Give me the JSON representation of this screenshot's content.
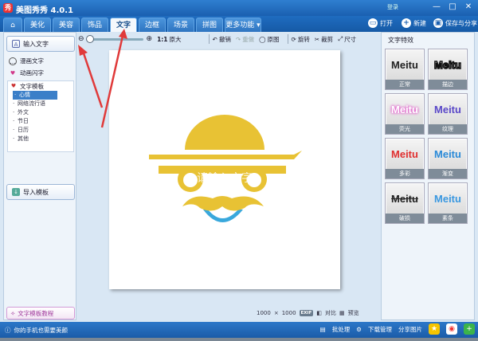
{
  "window": {
    "title": "美图秀秀 4.0.1",
    "controls": [
      "—",
      "□",
      "✕"
    ],
    "login": "登录"
  },
  "tabs": [
    {
      "id": "home",
      "label": "⌂",
      "active": false
    },
    {
      "id": "beautify",
      "label": "美化",
      "active": false
    },
    {
      "id": "face",
      "label": "美容",
      "active": false
    },
    {
      "id": "decor",
      "label": "饰品",
      "active": false
    },
    {
      "id": "text",
      "label": "文字",
      "active": true
    },
    {
      "id": "frame",
      "label": "边框",
      "active": false
    },
    {
      "id": "scene",
      "label": "场景",
      "active": false
    },
    {
      "id": "collage",
      "label": "拼图",
      "active": false
    },
    {
      "id": "more",
      "label": "更多功能 ▾",
      "active": false
    }
  ],
  "header_actions": {
    "open": "打开",
    "new": "新建",
    "save": "保存与分享"
  },
  "toolbar": {
    "original_size": "原大",
    "undo": "撤销",
    "redo": "重做",
    "original_image": "原图",
    "rotate": "旋转",
    "crop": "裁剪",
    "size": "尺寸"
  },
  "left_panel": {
    "input_text": "输入文字",
    "comic_text": "漫画文字",
    "animated_text": "动画闪字",
    "template_title": "文字模板",
    "templates": [
      "心情",
      "网络流行语",
      "外文",
      "节日",
      "日历",
      "其他"
    ],
    "import_template": "导入模板",
    "tutorial": "文字模板教程"
  },
  "canvas": {
    "overlay_text": "请输入文字",
    "width": "1000",
    "times": "×",
    "height": "1000",
    "exif": "EXIF",
    "compare": "对比",
    "preview": "预览"
  },
  "right_panel": {
    "title": "文字特效",
    "effects": [
      {
        "label": "正常",
        "preview": "Meitu",
        "color": "#222222"
      },
      {
        "label": "描边",
        "preview": "Meitu",
        "color": "#ffffff"
      },
      {
        "label": "荧光",
        "preview": "Meitu",
        "color": "#ffffff"
      },
      {
        "label": "纹理",
        "preview": "Meitu",
        "color": "#5a48c8"
      },
      {
        "label": "多彩",
        "preview": "Meitu",
        "color": "#e03030"
      },
      {
        "label": "渐变",
        "preview": "Meitu",
        "color": "#2a8ad8"
      },
      {
        "label": "破损",
        "preview": "Meitu",
        "color": "#222222"
      },
      {
        "label": "素条",
        "preview": "Meitu",
        "color": "#3a98e0"
      }
    ]
  },
  "status_bar": {
    "left_text": "你的手机也需要美颜",
    "batch": "批处理",
    "download_manager": "下载管理",
    "share_image": "分享图片"
  },
  "colors": {
    "accent": "#1a5fb0",
    "hat": "#e8c234",
    "smile": "#39a8dc",
    "arrow": "#e03a3a"
  }
}
